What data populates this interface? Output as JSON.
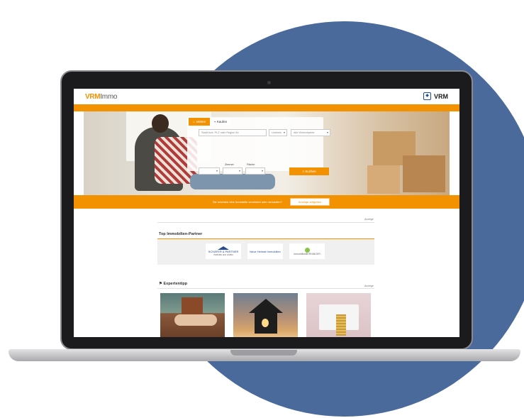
{
  "header": {
    "logo_vrm": "VRM",
    "logo_immo": "Immo",
    "brand_right": "VRM"
  },
  "search": {
    "tabs": [
      {
        "label": "Mieten",
        "icon": "home-icon"
      },
      {
        "label": "Kaufen",
        "icon": "building-icon"
      }
    ],
    "location_placeholder": "Stadt bzw. PLZ oder Region für",
    "umkreis": "Umkreis",
    "property_type": "Alle Wohnobjekte",
    "zimmer_label": "Zimmer",
    "flaeche_label": "Fläche",
    "button_label": "Suchen"
  },
  "cta": {
    "text": "Sie möchten eine Immobilie vermieten oder verkaufen?",
    "button_label": "Anzeige aufgeben"
  },
  "sections": {
    "anzeige": "Anzeige",
    "partners_title": "Top Immobilien-Partner",
    "partners": [
      {
        "name": "SCHÄFER & PARTNER",
        "sub": "IMMOBILIEN GMBH"
      },
      {
        "name": "Neue Heimat Immobilien",
        "sub": ""
      },
      {
        "name": "ImmobilienBERNINGER",
        "sub": ""
      }
    ],
    "experten_title": "Expertentipp",
    "experten_anzeige": "Anzeige"
  },
  "colors": {
    "accent": "#f39200",
    "circle": "#4a6a9c"
  }
}
